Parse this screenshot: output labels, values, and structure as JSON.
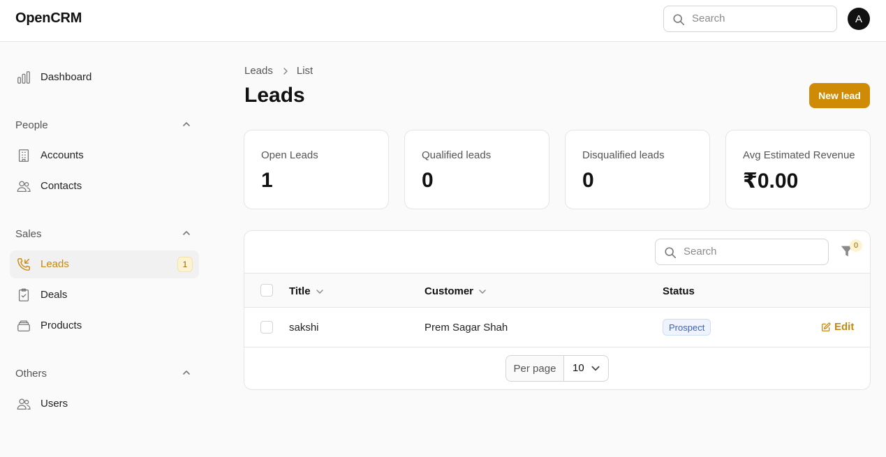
{
  "app": {
    "brand": "OpenCRM"
  },
  "topbar": {
    "search_placeholder": "Search",
    "avatar_initial": "A"
  },
  "sidebar": {
    "dashboard": "Dashboard",
    "groups": [
      {
        "label": "People",
        "items": [
          "Accounts",
          "Contacts"
        ]
      },
      {
        "label": "Sales",
        "items": [
          "Leads",
          "Deals",
          "Products"
        ]
      },
      {
        "label": "Others",
        "items": [
          "Users"
        ]
      }
    ],
    "leads_badge": "1",
    "active_item": "Leads",
    "accent": "#c8870a"
  },
  "breadcrumb": [
    "Leads",
    "List"
  ],
  "page": {
    "title": "Leads",
    "new_button": "New lead"
  },
  "stats": [
    {
      "label": "Open Leads",
      "value": "1"
    },
    {
      "label": "Qualified leads",
      "value": "0"
    },
    {
      "label": "Disqualified leads",
      "value": "0"
    },
    {
      "label": "Avg Estimated Revenue",
      "value": "₹0.00"
    }
  ],
  "table": {
    "search_placeholder": "Search",
    "filter_count": "0",
    "columns": [
      "Title",
      "Customer",
      "Status"
    ],
    "rows": [
      {
        "title": "sakshi",
        "customer": "Prem Sagar Shah",
        "status": "Prospect",
        "action": "Edit"
      }
    ],
    "per_page_label": "Per page",
    "per_page_value": "10"
  }
}
